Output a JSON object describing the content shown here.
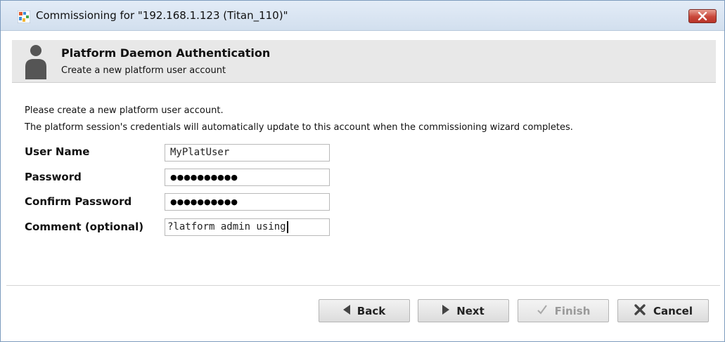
{
  "window": {
    "title": "Commissioning for \"192.168.1.123 (Titan_110)\""
  },
  "header": {
    "title": "Platform Daemon Authentication",
    "subtitle": "Create a new platform user account"
  },
  "intro": {
    "line1": "Please create a new platform user account.",
    "line2": "The platform session's credentials will automatically update to this account when the commissioning wizard completes."
  },
  "form": {
    "user_name": {
      "label": "User Name",
      "value": "MyPlatUser"
    },
    "password": {
      "label": "Password",
      "value": "●●●●●●●●●●"
    },
    "confirm_password": {
      "label": "Confirm Password",
      "value": "●●●●●●●●●●"
    },
    "comment": {
      "label": "Comment (optional)",
      "value": "?latform admin using"
    }
  },
  "buttons": {
    "back": "Back",
    "next": "Next",
    "finish": "Finish",
    "cancel": "Cancel"
  },
  "icons": {
    "app": "niagara-app-icon",
    "close": "close-icon",
    "user": "user-icon",
    "back": "triangle-left-icon",
    "next": "triangle-right-icon",
    "finish": "checkmark-icon",
    "cancel": "x-icon"
  },
  "colors": {
    "titlebar": "#d2dfee",
    "close_button": "#c9473a",
    "header_bg": "#e8e8e8"
  }
}
